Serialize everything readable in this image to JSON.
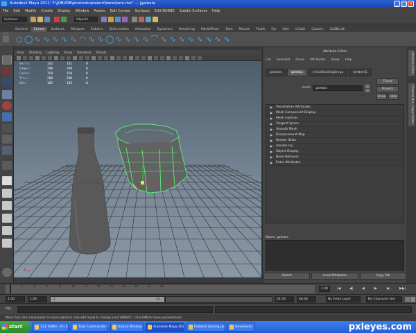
{
  "window": {
    "title": "Autodesk Maya 2011: F:\\JOBURB\\photoshoptalent\\bere\\bere.ma*   ---   |galeata",
    "controls": [
      "_",
      "□",
      "×"
    ]
  },
  "menubar": [
    "File",
    "Edit",
    "Modify",
    "Create",
    "Display",
    "Window",
    "Assets",
    "Edit Curves",
    "Surfaces",
    "Edit NURBS",
    "Subdiv Surfaces",
    "Help"
  ],
  "statusline": {
    "mode": "Surfaces",
    "object_field": "Objects"
  },
  "shelf_tabs": [
    "General",
    "Curves",
    "Surfaces",
    "Polygons",
    "Subdivs",
    "Deformation",
    "Animation",
    "Dynamics",
    "Rendering",
    "PaintEffects",
    "Toon",
    "Muscle",
    "Fluids",
    "Fur",
    "Hair",
    "nCloth",
    "Custom",
    "GoZBrush"
  ],
  "active_shelf_tab": "Curves",
  "shelf_icons": [
    "○",
    "◯",
    "∿",
    "∿",
    "∿",
    "∿",
    "∿",
    "◠",
    "∿",
    "∿",
    "◯",
    "∿",
    "∿",
    "∿",
    "∿",
    "⌒",
    "∿",
    "∿",
    "∿",
    "∿",
    "∿",
    "∿",
    "∿",
    "∿"
  ],
  "viewport": {
    "menu": [
      "View",
      "Shading",
      "Lighting",
      "Show",
      "Renderer",
      "Panels"
    ],
    "hud": [
      {
        "label": "Verts:",
        "a": "142",
        "b": "142",
        "c": "0"
      },
      {
        "label": "Edges:",
        "a": "290",
        "b": "290",
        "c": "0"
      },
      {
        "label": "Faces:",
        "a": "150",
        "b": "150",
        "c": "0"
      },
      {
        "label": "Tris:",
        "a": "280",
        "b": "280",
        "c": "0"
      },
      {
        "label": "UVs:",
        "a": "165",
        "b": "165",
        "c": "0"
      }
    ]
  },
  "attribute_editor": {
    "title": "Attribute Editor",
    "menu": [
      "List",
      "Selected",
      "Focus",
      "Attributes",
      "Show",
      "Help"
    ],
    "tabs": [
      "galeata",
      "galeata",
      "initialShadingGroup",
      "lambert1"
    ],
    "active_tab_index": 1,
    "buttons": {
      "focus": "Focus",
      "presets": "Presets",
      "show": "Show",
      "hide": "Hide"
    },
    "mesh_label": "mesh:",
    "mesh_value": "galeata",
    "sections": [
      "Tessellation Attributes",
      "Mesh Component Display",
      "Mesh Controls",
      "Tangent Space",
      "Smooth Mesh",
      "Displacement Map",
      "Render Stats",
      "mental ray",
      "Object Display",
      "Node Behavior",
      "Extra Attributes"
    ],
    "notes_label": "Notes: galeata",
    "bottom_buttons": [
      "Select",
      "Load Attributes",
      "Copy Tab"
    ]
  },
  "side_tabs": [
    "Attribute Editor",
    "Channel Box / Layer Editor"
  ],
  "time_slider": {
    "ticks": [
      "2",
      "4",
      "6",
      "8",
      "10",
      "12",
      "14",
      "16",
      "18",
      "20",
      "22",
      "24"
    ],
    "current_frame": "1.00",
    "playback": [
      "|◀",
      "◀|",
      "◀",
      "▶",
      "▶|",
      "▶▶|"
    ]
  },
  "range_slider": {
    "start": "1.00",
    "inner_start": "1.00",
    "knob_start": "1",
    "knob_end": "24",
    "inner_end": "24.00",
    "end": "48.00",
    "anim_layer": "No Anim Layer",
    "character_set": "No Character Set"
  },
  "mel": {
    "label": "MEL"
  },
  "help_line": "Move Tool: Use manipulator to move object(s). Use edit mode to change pivot (INSERT). Ctrl+LMB to move perpendicular.",
  "taskbar": {
    "start": "start",
    "items": [
      "113. KidRn - It's On -",
      "Total Commander 6.0...",
      "Output Window",
      "Autodesk Maya 2011...",
      "Problem loading page...",
      "Downloads"
    ],
    "active_index": 3
  },
  "watermark": "pxleyes.com",
  "colors": {
    "title_bg": "#2a5fd0",
    "mesh_wire": "#5af07a",
    "grid": "#2e2e2e",
    "taskbar": "#245ed8"
  }
}
